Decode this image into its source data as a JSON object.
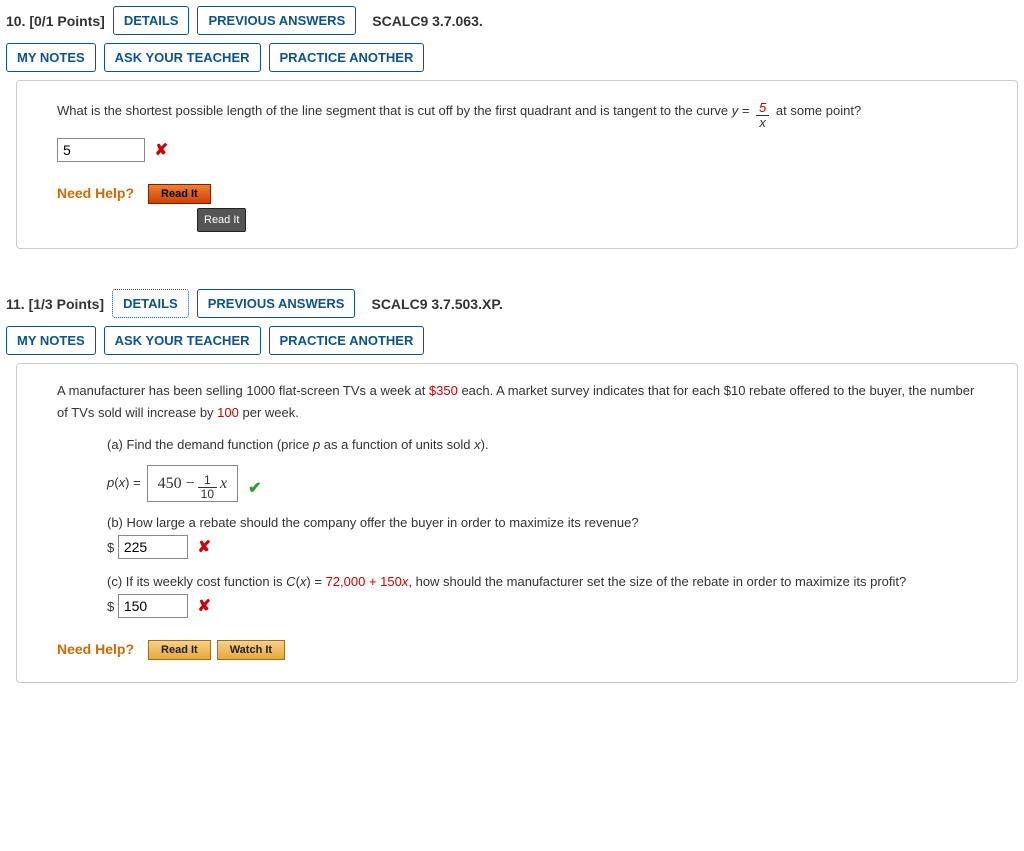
{
  "q10": {
    "num": "10.",
    "points": "[0/1 Points]",
    "details_btn": "DETAILS",
    "prev_btn": "PREVIOUS ANSWERS",
    "bookref": "SCALC9 3.7.063.",
    "mynotes_btn": "MY NOTES",
    "askteacher_btn": "ASK YOUR TEACHER",
    "practice_btn": "PRACTICE ANOTHER",
    "prompt_a": "What is the shortest possible length of the line segment that is cut off by the first quadrant and is tangent to the curve ",
    "prompt_y": "y",
    "prompt_eq": " = ",
    "frac_num": "5",
    "frac_den": "x",
    "prompt_b": " at some point?",
    "answer": "5",
    "need_help": "Need Help?",
    "readit": "Read It",
    "tooltip": "Read It"
  },
  "q11": {
    "num": "11.",
    "points": "[1/3 Points]",
    "details_btn": "DETAILS",
    "prev_btn": "PREVIOUS ANSWERS",
    "bookref": "SCALC9 3.7.503.XP.",
    "mynotes_btn": "MY NOTES",
    "askteacher_btn": "ASK YOUR TEACHER",
    "practice_btn": "PRACTICE ANOTHER",
    "intro_a": "A manufacturer has been selling 1000 flat-screen TVs a week at ",
    "intro_price": "$350",
    "intro_b": " each. A market survey indicates that for each $10 rebate offered to the buyer, the number of TVs sold will increase by ",
    "intro_inc": "100",
    "intro_c": " per week.",
    "part_a": "(a) Find the demand function (price p as a function of units sold x).",
    "px_label": "p(x) = ",
    "px_const": "450 − ",
    "px_num": "1",
    "px_den": "10",
    "px_var": "x",
    "part_b": "(b) How large a rebate should the company offer the buyer in order to maximize its revenue?",
    "dollar": "$",
    "ans_b": "225",
    "part_c_a": "(c) If its weekly cost function is ",
    "part_c_fun": "C(x)",
    "part_c_eq": " = ",
    "part_c_cost": "72,000 + 150x",
    "part_c_b": ", how should the manufacturer set the size of the rebate in order to maximize its profit?",
    "ans_c": "150",
    "need_help": "Need Help?",
    "readit": "Read It",
    "watchit": "Watch It"
  }
}
